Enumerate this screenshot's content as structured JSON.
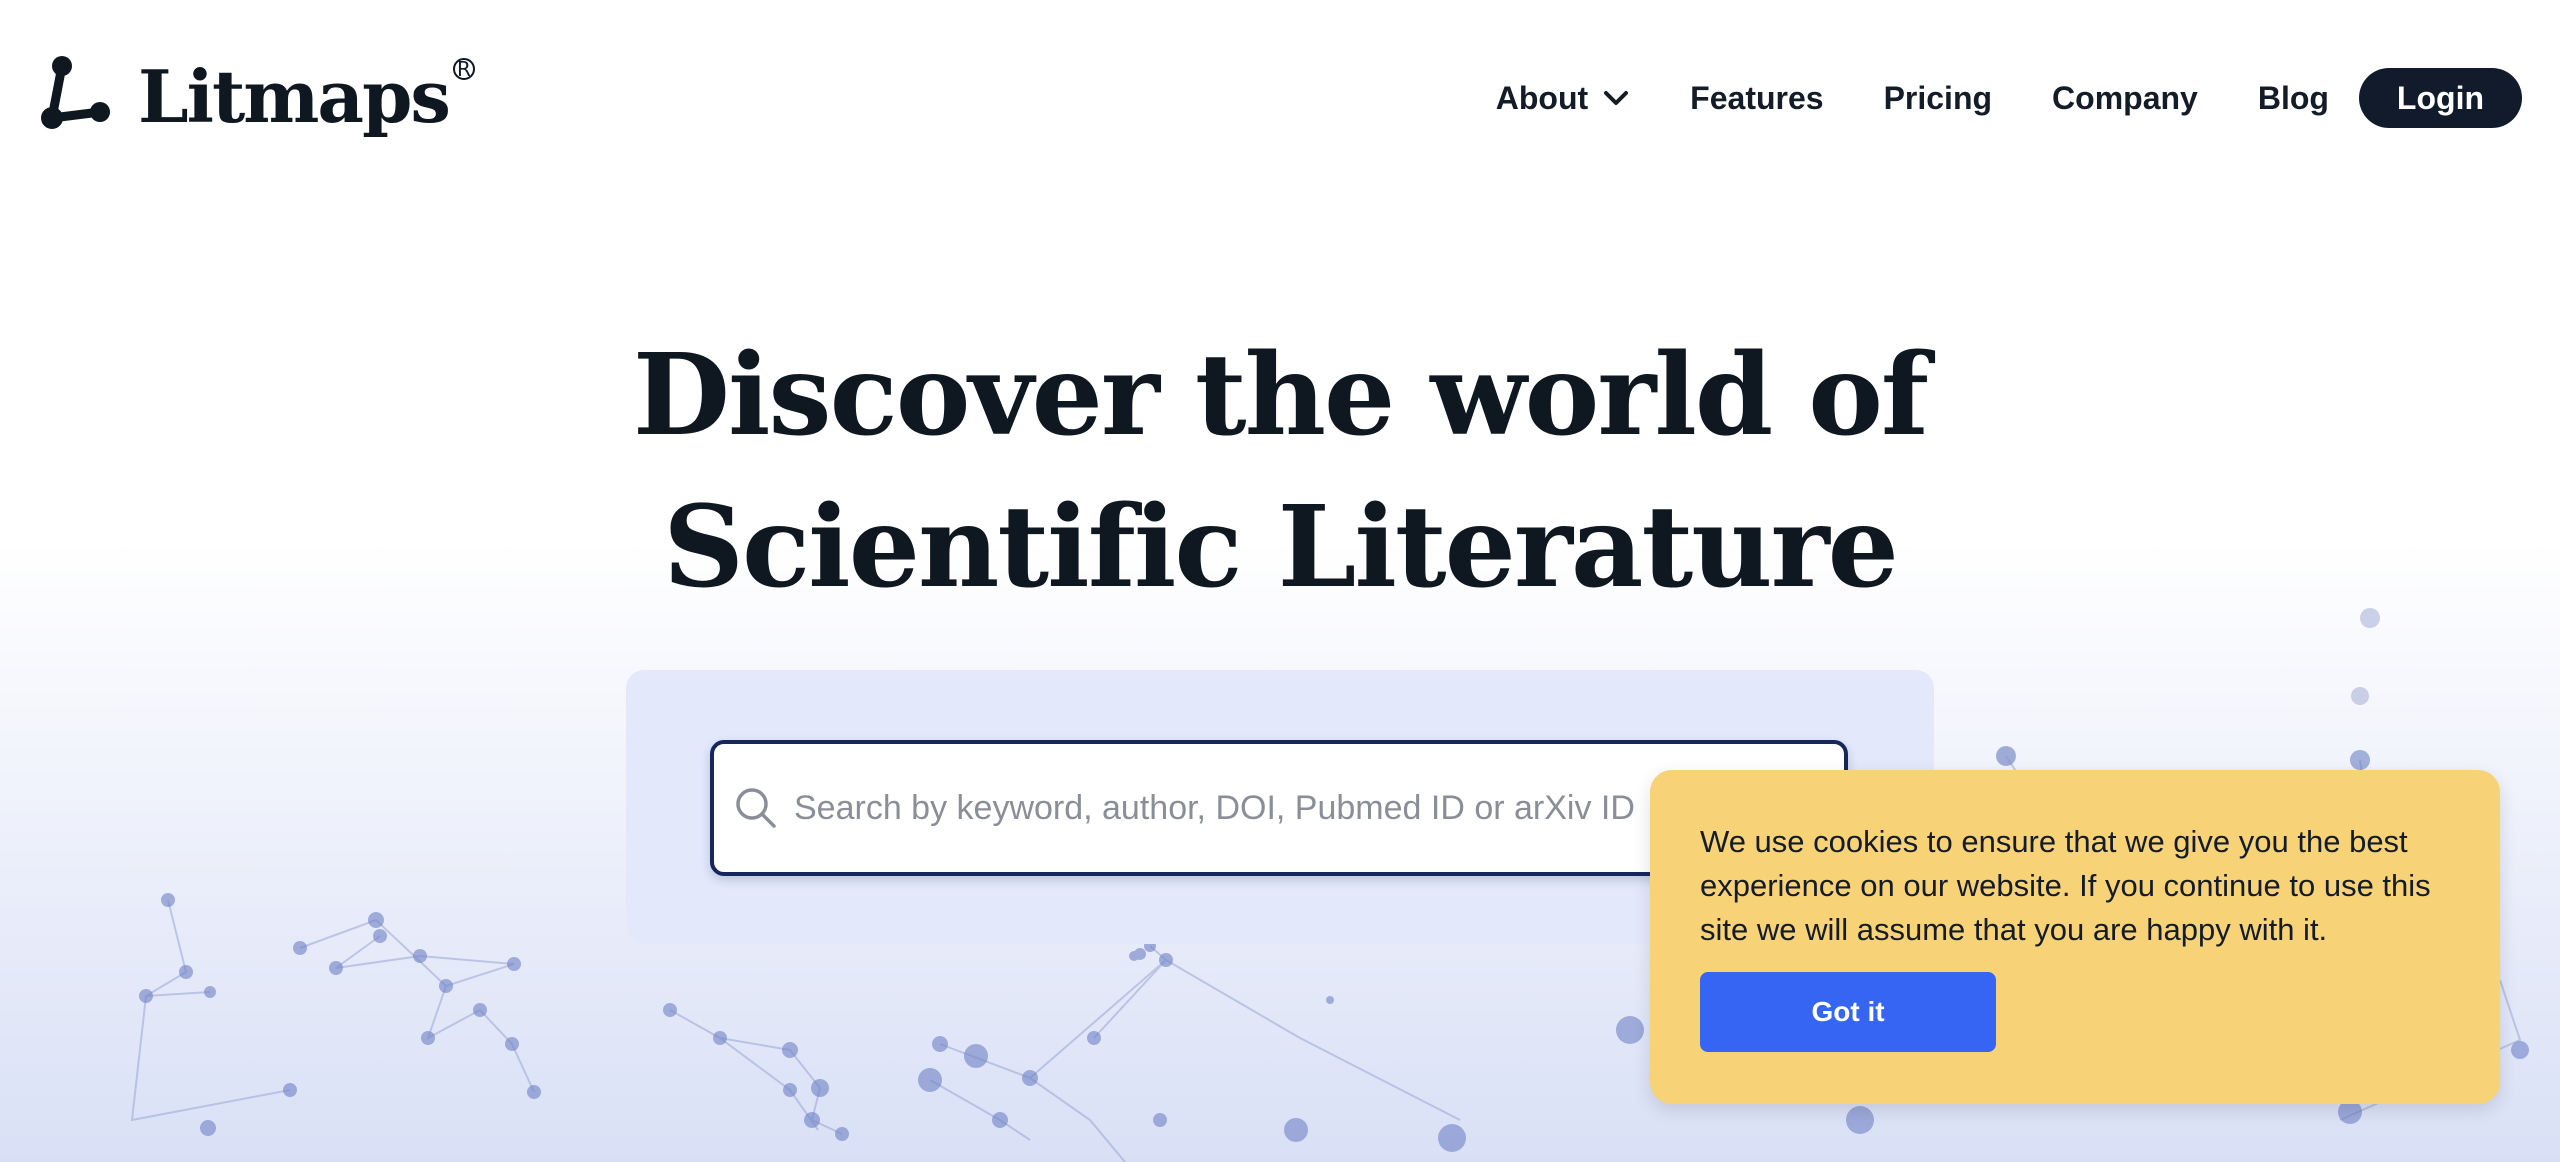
{
  "brand": {
    "name": "Litmaps",
    "registered_mark": "R"
  },
  "nav": {
    "items": [
      {
        "label": "About",
        "has_dropdown": true
      },
      {
        "label": "Features"
      },
      {
        "label": "Pricing"
      },
      {
        "label": "Company"
      },
      {
        "label": "Blog"
      }
    ],
    "login_label": "Login"
  },
  "hero": {
    "title_line1": "Discover the world of",
    "title_line2": "Scientific Literature"
  },
  "search": {
    "placeholder": "Search by keyword, author, DOI, Pubmed ID or arXiv ID",
    "value": ""
  },
  "cookie_banner": {
    "message": "We use cookies to ensure that we give you the best experience on our website. If you continue to use this site we will assume that you are happy with it.",
    "button_label": "Got it"
  },
  "colors": {
    "text_dark": "#101b2a",
    "login_bg": "#111b2b",
    "search_panel": "#e3e9fb",
    "search_border": "#16275c",
    "cookie_bg": "#f7d277",
    "cookie_button": "#3565f2",
    "network_nodes": "#6f82c6"
  },
  "icons": {
    "logo": "litmaps-network-icon",
    "about_dropdown": "chevron-down-icon",
    "search": "search-icon"
  }
}
